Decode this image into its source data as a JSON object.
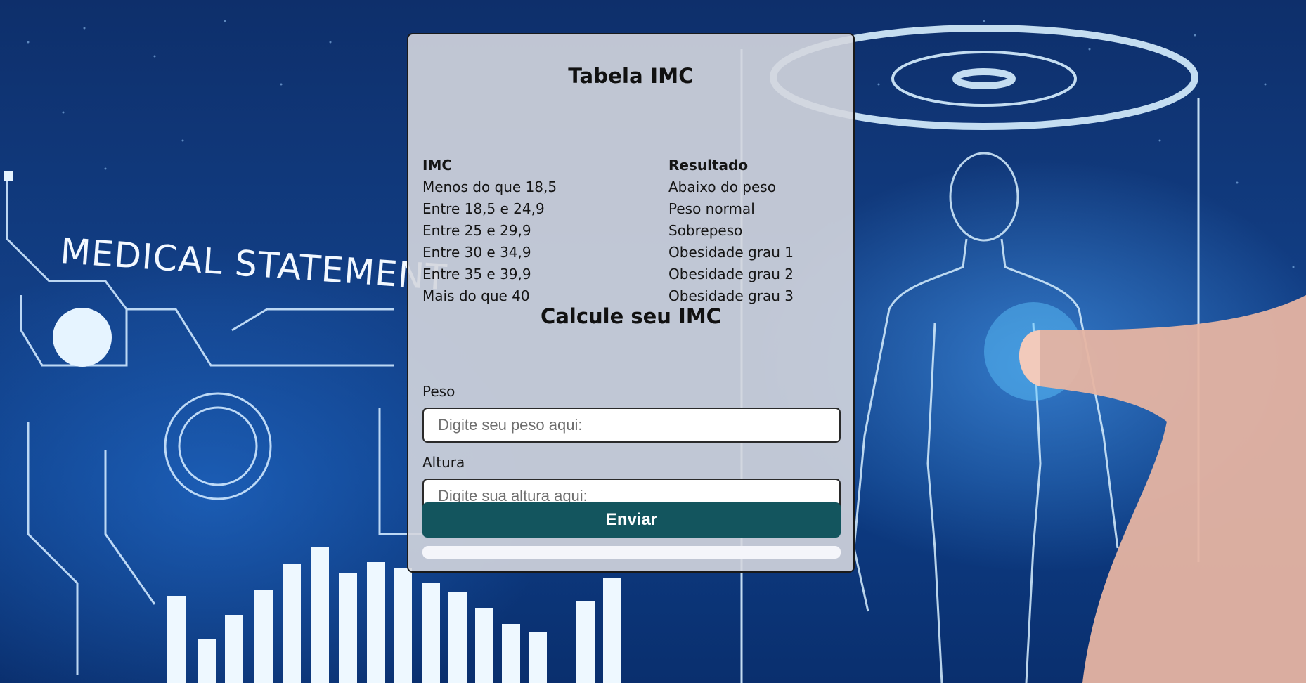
{
  "background": {
    "banner_text": "MEDICAL STATEMENT"
  },
  "card": {
    "title": "Tabela IMC",
    "table": {
      "headers": [
        "IMC",
        "Resultado"
      ],
      "rows": [
        [
          "Menos do que 18,5",
          "Abaixo do peso"
        ],
        [
          "Entre 18,5 e 24,9",
          "Peso normal"
        ],
        [
          "Entre 25 e 29,9",
          "Sobrepeso"
        ],
        [
          "Entre 30 e 34,9",
          "Obesidade grau 1"
        ],
        [
          "Entre 35 e 39,9",
          "Obesidade grau 2"
        ],
        [
          "Mais do que 40",
          "Obesidade grau 3"
        ]
      ]
    },
    "form": {
      "title": "Calcule seu IMC",
      "peso_label": "Peso",
      "peso_placeholder": "Digite seu peso aqui:",
      "peso_value": "",
      "altura_label": "Altura",
      "altura_placeholder": "Digite sua altura aqui:",
      "altura_value": "",
      "submit_label": "Enviar",
      "result_text": ""
    }
  },
  "colors": {
    "button": "#13555e",
    "card_background": "#d4d6de"
  }
}
